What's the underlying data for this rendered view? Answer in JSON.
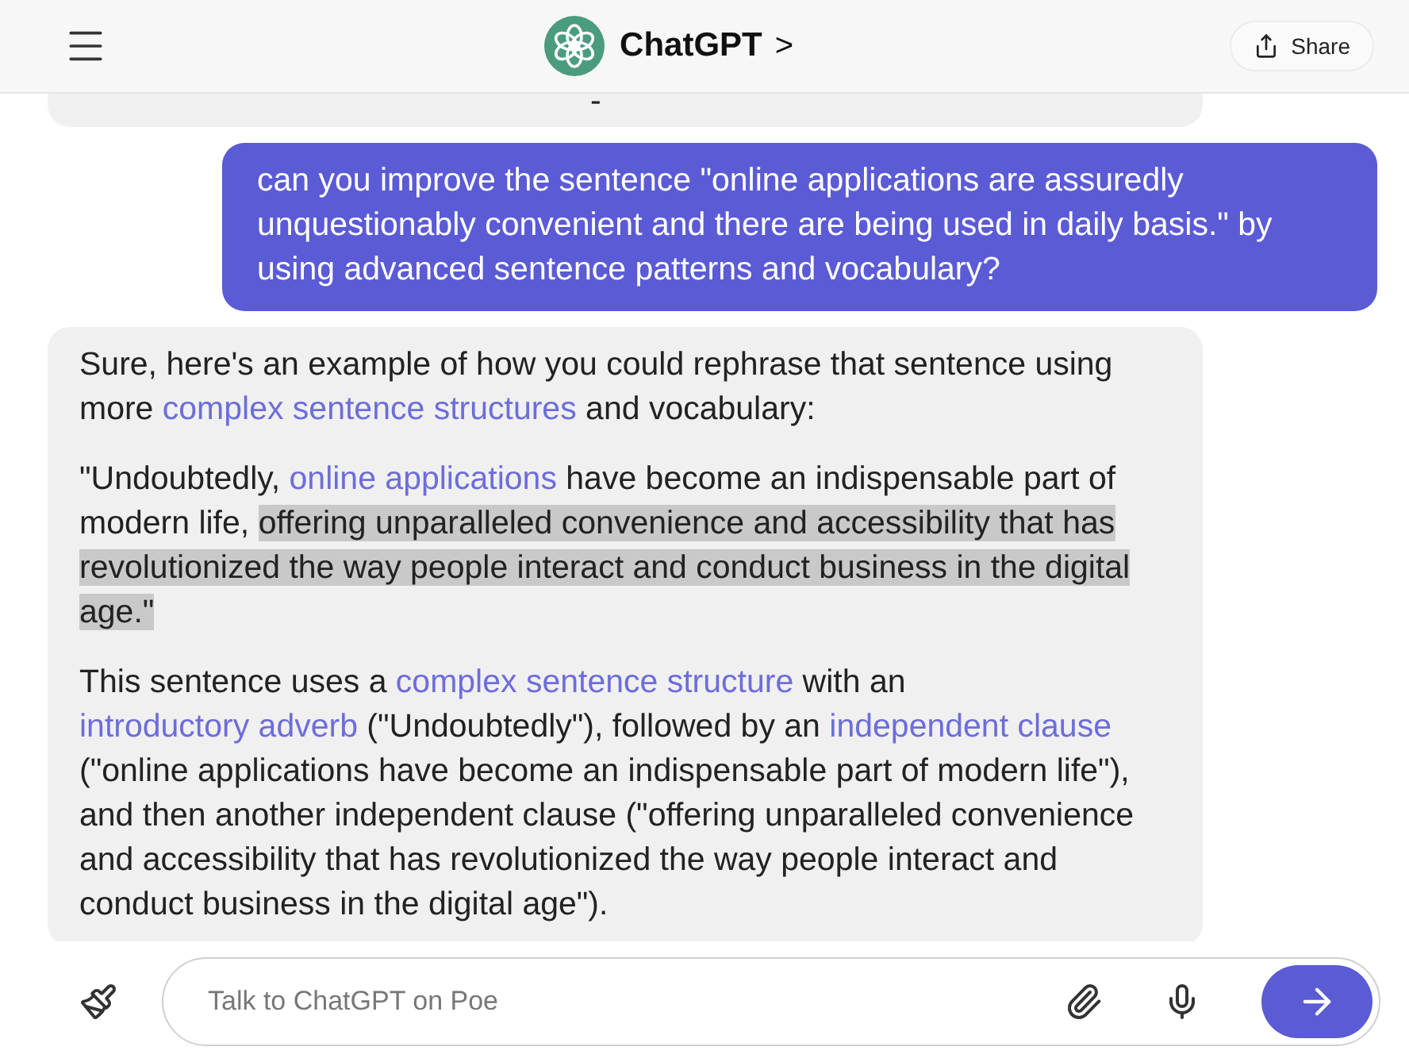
{
  "header": {
    "title": "ChatGPT",
    "chevron": ">",
    "share_label": "Share"
  },
  "messages": [
    {
      "kind": "bot",
      "cut_top": true,
      "paragraphs": [
        [
          {
            "kind": "plain",
            "text": "-"
          }
        ]
      ]
    },
    {
      "kind": "user",
      "cut_top": false,
      "paragraphs": [
        [
          {
            "kind": "plain",
            "text": "can you improve the sentence \"online applications are assuredly unquestionably convenient and there are being used in daily basis.\" by using advanced sentence patterns and vocabulary?"
          }
        ]
      ]
    },
    {
      "kind": "bot",
      "cut_top": false,
      "paragraphs": [
        [
          {
            "kind": "plain",
            "text": "Sure, here's an example of how you could rephrase that sentence using more "
          },
          {
            "kind": "link",
            "text": "complex sentence structures"
          },
          {
            "kind": "plain",
            "text": " and vocabulary:"
          }
        ],
        [
          {
            "kind": "plain",
            "text": "\"Undoubtedly, "
          },
          {
            "kind": "link",
            "text": "online applications"
          },
          {
            "kind": "plain",
            "text": " have become an indispensable part of modern life, "
          },
          {
            "kind": "highlight",
            "text": "offering unparalleled convenience and accessibility that has revolutionized the way people interact and conduct business in the digital age.\""
          }
        ],
        [
          {
            "kind": "plain",
            "text": "This sentence uses a "
          },
          {
            "kind": "link",
            "text": "complex sentence structure"
          },
          {
            "kind": "plain",
            "text": " with an "
          },
          {
            "kind": "link",
            "text": "introductory adverb"
          },
          {
            "kind": "plain",
            "text": " (\"Undoubtedly\"), followed by an "
          },
          {
            "kind": "link",
            "text": "independent clause"
          },
          {
            "kind": "plain",
            "text": " (\"online applications have become an indispensable part of modern life\"), and then another independent clause (\"offering unparalleled convenience and accessibility that has revolutionized the way people interact and conduct business in the digital age\")."
          }
        ]
      ]
    }
  ],
  "composer": {
    "placeholder": "Talk to ChatGPT on Poe"
  }
}
